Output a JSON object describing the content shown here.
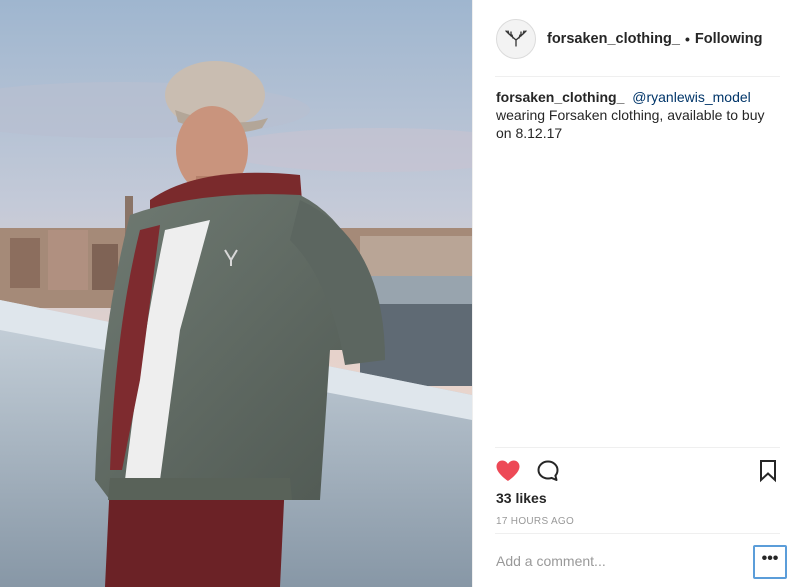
{
  "post": {
    "username": "forsaken_clothing_",
    "separator": "•",
    "follow_status": "Following",
    "caption": {
      "username": "forsaken_clothing_",
      "mention": "@ryanlewis_model",
      "text": "wearing Forsaken clothing, available to buy on 8.12.17"
    },
    "likes": "33 likes",
    "timestamp": "17 HOURS AGO",
    "comment_placeholder": "Add a comment...",
    "more_label": "•••"
  },
  "icons": {
    "avatar": "antler-logo-icon",
    "like": "heart-filled-icon",
    "comment": "speech-bubble-icon",
    "save": "bookmark-icon",
    "more": "ellipsis-icon"
  },
  "colors": {
    "like_red": "#ed4956",
    "mention_blue": "#003569",
    "focus_blue": "#5b9dd9",
    "muted_gray": "#999999"
  }
}
